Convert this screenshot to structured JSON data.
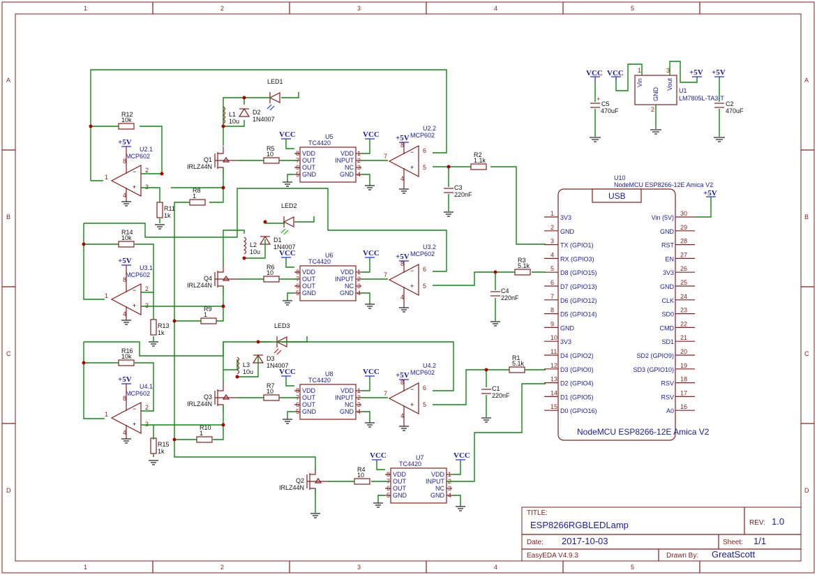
{
  "border": {
    "columns": [
      "1",
      "2",
      "3",
      "4",
      "5"
    ],
    "rows": [
      "A",
      "B",
      "C",
      "D"
    ]
  },
  "title_block": {
    "title_label": "TITLE:",
    "title": "ESP8266RGBLEDLamp",
    "rev_label": "REV:",
    "rev": "1.0",
    "date_label": "Date:",
    "date": "2017-10-03",
    "sheet_label": "Sheet:",
    "sheet": "1/1",
    "tool": "EasyEDA V4.9.3",
    "drawn_label": "Drawn By:",
    "drawn_by": "GreatScott"
  },
  "power": {
    "vcc": "VCC",
    "p5v": "+5V"
  },
  "regulator": {
    "ref": "U1",
    "part": "LM7805L-TA3-T",
    "pin_in": "Vin",
    "pin_gnd": "GND",
    "pin_out": "Vout",
    "n1": "1",
    "n2": "2",
    "n3": "3",
    "c5_ref": "C5",
    "c5_val": "470uF",
    "c2_ref": "C2",
    "c2_val": "470uF"
  },
  "mcu": {
    "ref": "U10",
    "name": "NodeMCU ESP8266-12E Amica V2",
    "usb": "USB",
    "footer": "NodeMCU ESP8266-12E Amica V2",
    "left_pins": [
      {
        "n": "1",
        "label": "3V3"
      },
      {
        "n": "2",
        "label": "GND"
      },
      {
        "n": "3",
        "label": "TX (GPIO1)"
      },
      {
        "n": "4",
        "label": "RX (GPIO3)"
      },
      {
        "n": "5",
        "label": "D8 (GPIO15)"
      },
      {
        "n": "6",
        "label": "D7 (GPIO13)"
      },
      {
        "n": "7",
        "label": "D6 (GPIO12)"
      },
      {
        "n": "8",
        "label": "D5 (GPIO14)"
      },
      {
        "n": "9",
        "label": "GND"
      },
      {
        "n": "10",
        "label": "3V3"
      },
      {
        "n": "11",
        "label": "D4 (GPIO2)"
      },
      {
        "n": "12",
        "label": "D3 (GPIO0)"
      },
      {
        "n": "13",
        "label": "D2 (GPIO4)"
      },
      {
        "n": "14",
        "label": "D1 (GPIO5)"
      },
      {
        "n": "15",
        "label": "D0 (GPIO16)"
      }
    ],
    "right_pins": [
      {
        "n": "30",
        "label": "Vin (5V)"
      },
      {
        "n": "29",
        "label": "GND"
      },
      {
        "n": "28",
        "label": "RST"
      },
      {
        "n": "27",
        "label": "EN"
      },
      {
        "n": "26",
        "label": "3V3"
      },
      {
        "n": "25",
        "label": "GND"
      },
      {
        "n": "24",
        "label": "CLK"
      },
      {
        "n": "23",
        "label": "SD0"
      },
      {
        "n": "22",
        "label": "CMD"
      },
      {
        "n": "21",
        "label": "SD1"
      },
      {
        "n": "20",
        "label": "SD2 (GPIO9)"
      },
      {
        "n": "19",
        "label": "SD3 (GPIO10)"
      },
      {
        "n": "18",
        "label": "RSV"
      },
      {
        "n": "17",
        "label": "RSV"
      },
      {
        "n": "16",
        "label": "A0"
      }
    ]
  },
  "drivers": {
    "part": "TC4420",
    "pins_left": [
      "VDD",
      "OUT",
      "OUT",
      "GND"
    ],
    "pins_right": [
      "VDD",
      "INPUT",
      "NC",
      "GND"
    ],
    "nums_left": [
      "8",
      "7",
      "6",
      "5"
    ],
    "nums_right": [
      "1",
      "2",
      "3",
      "4"
    ],
    "refs": [
      "U5",
      "U6",
      "U8",
      "U7"
    ]
  },
  "opamp": {
    "part": "MCP602",
    "refs": [
      "U2.2",
      "U3.2",
      "U4.2",
      "U2.1",
      "U3.1",
      "U4.1"
    ],
    "pins_ch2": [
      "6",
      "7",
      "5"
    ],
    "pins_ch1": [
      "2",
      "1",
      "3"
    ],
    "pwr": [
      "8",
      "4"
    ]
  },
  "mosfets": {
    "part": "IRLZ44N",
    "refs": [
      "Q1",
      "Q4",
      "Q3",
      "Q2"
    ]
  },
  "leds": [
    "LED1",
    "LED2",
    "LED3"
  ],
  "inductors": [
    {
      "ref": "L1",
      "val": "10u"
    },
    {
      "ref": "L2",
      "val": "10u"
    },
    {
      "ref": "L3",
      "val": "10u"
    }
  ],
  "diodes": [
    {
      "ref": "D2",
      "val": "1N4007"
    },
    {
      "ref": "D1",
      "val": "1N4007"
    },
    {
      "ref": "D3",
      "val": "1N4007"
    }
  ],
  "resistors": {
    "R5": "10",
    "R6": "10",
    "R7": "10",
    "R4": "10",
    "R8": "1",
    "R9": "1",
    "R10": "1",
    "R11": "1k",
    "R13": "1k",
    "R15": "1k",
    "R12": "10k",
    "R14": "10k",
    "R16": "10k",
    "R2": "1.1k",
    "R3": "5.1k",
    "R1": "5.1k"
  },
  "caps": {
    "C3": "220nF",
    "C4": "220nF",
    "C1": "220nF"
  }
}
